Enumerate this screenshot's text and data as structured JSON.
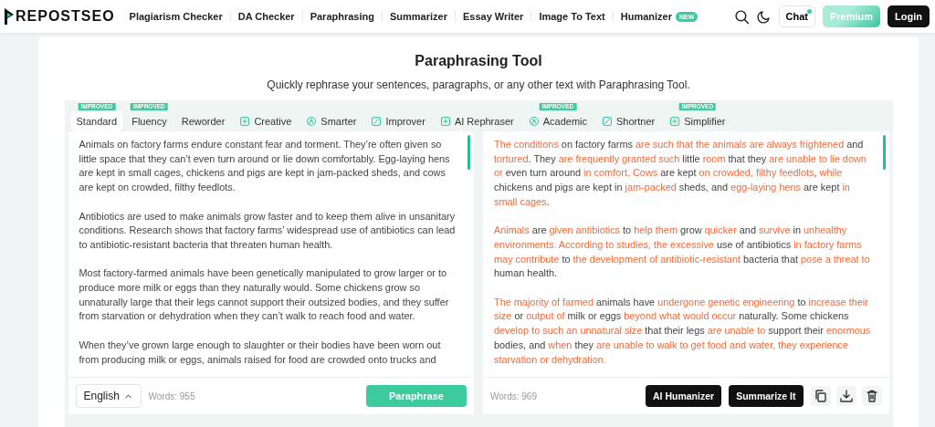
{
  "header": {
    "logo": "REPOSTSEO",
    "nav": [
      {
        "label": "Plagiarism Checker"
      },
      {
        "label": "DA Checker"
      },
      {
        "label": "Paraphrasing"
      },
      {
        "label": "Summarizer"
      },
      {
        "label": "Essay Writer"
      },
      {
        "label": "Image To Text"
      },
      {
        "label": "Humanizer",
        "badge": "NEW"
      }
    ],
    "chat": "Chat",
    "premium": "Premium",
    "login": "Login"
  },
  "title": "Paraphrasing Tool",
  "subtitle": "Quickly rephrase your sentences, paragraphs, or any other text with Paraphrasing Tool.",
  "modes": [
    {
      "label": "Standard",
      "selected": true,
      "kind": "plain",
      "badge": "IMPROVED"
    },
    {
      "label": "Fluency",
      "selected": false,
      "kind": "plain",
      "badge": "IMPROVED"
    },
    {
      "label": "Reworder",
      "selected": false,
      "kind": "plain"
    },
    {
      "label": "Creative",
      "selected": false,
      "kind": "icon"
    },
    {
      "label": "Smarter",
      "selected": false,
      "kind": "icon"
    },
    {
      "label": "Improver",
      "selected": false,
      "kind": "icon"
    },
    {
      "label": "AI Rephraser",
      "selected": false,
      "kind": "icon"
    },
    {
      "label": "Academic",
      "selected": false,
      "kind": "icon",
      "badge": "IMPROVED"
    },
    {
      "label": "Shortner",
      "selected": false,
      "kind": "icon"
    },
    {
      "label": "Simplifier",
      "selected": false,
      "kind": "icon",
      "badge": "IMPROVED"
    }
  ],
  "input": {
    "paragraphs": [
      "Animals on factory farms endure constant fear and torment. They’re often given so little space that they can’t even turn around or lie down comfortably. Egg-laying hens are kept in small cages, chickens and pigs are kept in jam-packed sheds, and cows are kept on crowded, filthy feedlots.",
      "Antibiotics are used to make animals grow faster and to keep them alive in unsanitary conditions. Research shows that factory farms’ widespread use of antibiotics can lead to antibiotic-resistant bacteria that threaten human health.",
      "Most factory-farmed animals have been genetically manipulated to grow larger or to produce more milk or eggs than they naturally would. Some chickens grow so unnaturally large that their legs cannot support their outsized bodies, and they suffer from starvation or dehydration when they can’t walk to reach food and water.",
      "When they’ve grown large enough to slaughter or their bodies have been worn out from producing milk or eggs, animals raised for food are crowded onto trucks and"
    ],
    "language": "English",
    "words": "Words: 955",
    "button": "Paraphrase"
  },
  "output": {
    "paragraphs": [
      [
        {
          "text": "The conditions",
          "changed": true
        },
        {
          "text": " on factory farms ",
          "changed": false
        },
        {
          "text": "are such that the animals are always frightened",
          "changed": true
        },
        {
          "text": " and ",
          "changed": false
        },
        {
          "text": "tortured",
          "changed": true
        },
        {
          "text": ". They ",
          "changed": false
        },
        {
          "text": "are frequently granted such",
          "changed": true
        },
        {
          "text": " little ",
          "changed": false
        },
        {
          "text": "room",
          "changed": true
        },
        {
          "text": " that they ",
          "changed": false
        },
        {
          "text": "are unable to lie down or",
          "changed": true
        },
        {
          "text": " even turn around ",
          "changed": false
        },
        {
          "text": "in comfort. ",
          "changed": true
        },
        {
          "text": "Cows",
          "changed": true
        },
        {
          "text": " are kept ",
          "changed": false
        },
        {
          "text": "on crowded, filthy feedlots",
          "changed": true
        },
        {
          "text": ", ",
          "changed": false
        },
        {
          "text": "while",
          "changed": true
        },
        {
          "text": " chickens and pigs are kept in ",
          "changed": false
        },
        {
          "text": "jam-packed",
          "changed": true
        },
        {
          "text": " sheds, and ",
          "changed": false
        },
        {
          "text": "egg-laying hens",
          "changed": true
        },
        {
          "text": " are kept ",
          "changed": false
        },
        {
          "text": "in small cages",
          "changed": true
        },
        {
          "text": ".",
          "changed": false
        }
      ],
      [
        {
          "text": "Animals",
          "changed": true
        },
        {
          "text": " are ",
          "changed": false
        },
        {
          "text": "given antibiotics",
          "changed": true
        },
        {
          "text": " to ",
          "changed": false
        },
        {
          "text": "help them",
          "changed": true
        },
        {
          "text": " grow ",
          "changed": false
        },
        {
          "text": "quicker",
          "changed": true
        },
        {
          "text": " and ",
          "changed": false
        },
        {
          "text": "survive",
          "changed": true
        },
        {
          "text": " in ",
          "changed": false
        },
        {
          "text": "unhealthy environments. According to studies, the excessive",
          "changed": true
        },
        {
          "text": " use of antibiotics ",
          "changed": false
        },
        {
          "text": "in factory farms may contribute",
          "changed": true
        },
        {
          "text": " to ",
          "changed": false
        },
        {
          "text": "the development of antibiotic-resistant",
          "changed": true
        },
        {
          "text": " bacteria that ",
          "changed": false
        },
        {
          "text": "pose a threat to",
          "changed": true
        },
        {
          "text": " human health.",
          "changed": false
        }
      ],
      [
        {
          "text": "The majority of farmed",
          "changed": true
        },
        {
          "text": " animals have ",
          "changed": false
        },
        {
          "text": "undergone genetic engineering",
          "changed": true
        },
        {
          "text": " to ",
          "changed": false
        },
        {
          "text": "increase their size",
          "changed": true
        },
        {
          "text": " or ",
          "changed": false
        },
        {
          "text": "output of",
          "changed": true
        },
        {
          "text": " milk or eggs ",
          "changed": false
        },
        {
          "text": "beyond what would occur",
          "changed": true
        },
        {
          "text": " naturally. Some chickens ",
          "changed": false
        },
        {
          "text": "develop to such an unnatural size",
          "changed": true
        },
        {
          "text": " that their legs ",
          "changed": false
        },
        {
          "text": "are unable to",
          "changed": true
        },
        {
          "text": " support their ",
          "changed": false
        },
        {
          "text": "enormous",
          "changed": true
        },
        {
          "text": " bodies, and ",
          "changed": false
        },
        {
          "text": "when",
          "changed": true
        },
        {
          "text": " they ",
          "changed": false
        },
        {
          "text": "are unable to walk to get food and water, they experience starvation or dehydration.",
          "changed": true
        }
      ]
    ],
    "words": "Words: 969",
    "buttons": [
      "AI Humanizer",
      "Summarize It"
    ]
  }
}
